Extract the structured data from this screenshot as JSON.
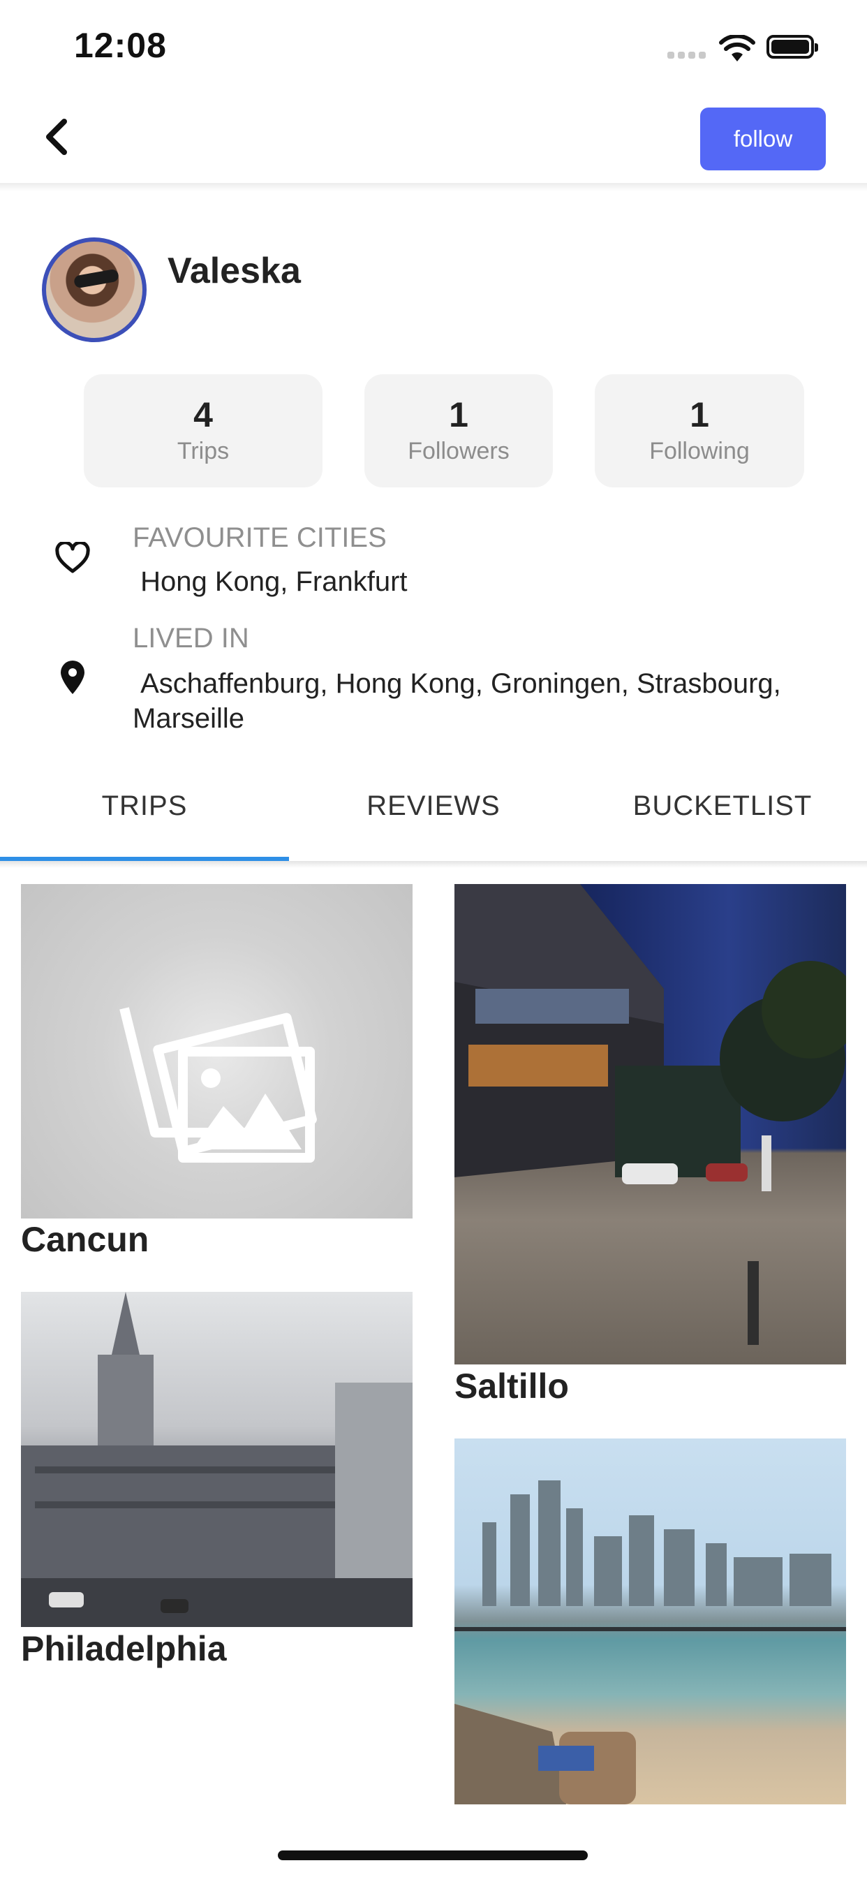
{
  "status_bar": {
    "time": "12:08"
  },
  "nav": {
    "follow_label": "follow"
  },
  "profile": {
    "name": "Valeska",
    "stats": [
      {
        "value": "4",
        "label": "Trips"
      },
      {
        "value": "1",
        "label": "Followers"
      },
      {
        "value": "1",
        "label": "Following"
      }
    ],
    "favourite_cities_label": "FAVOURITE CITIES",
    "favourite_cities": " Hong Kong, Frankfurt",
    "lived_in_label": "LIVED IN",
    "lived_in": " Aschaffenburg, Hong Kong, Groningen, Strasbourg, Marseille"
  },
  "tabs": {
    "items": [
      "TRIPS",
      "REVIEWS",
      "BUCKETLIST"
    ],
    "active": "TRIPS"
  },
  "trips": [
    {
      "title": "Cancun"
    },
    {
      "title": "Saltillo"
    },
    {
      "title": "Philadelphia"
    },
    {
      "title": ""
    }
  ],
  "colors": {
    "accent": "#5468f6",
    "tab_indicator": "#2e8fe6",
    "avatar_ring": "#3c4fb8"
  }
}
